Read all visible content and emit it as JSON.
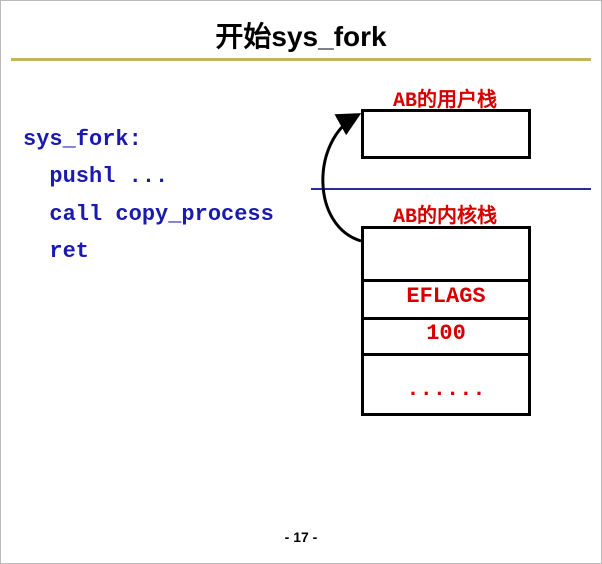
{
  "title": "开始sys_fork",
  "code": {
    "line1": "sys_fork:",
    "line2": "  pushl ...",
    "line3": "  call copy_process",
    "line4": "  ret"
  },
  "labels": {
    "user_stack": "AB的用户栈",
    "kernel_stack": "AB的内核栈"
  },
  "kernel_stack_rows": {
    "eflags": "EFLAGS",
    "val100": "100",
    "dots": "......"
  },
  "page_number": "- 17 -"
}
